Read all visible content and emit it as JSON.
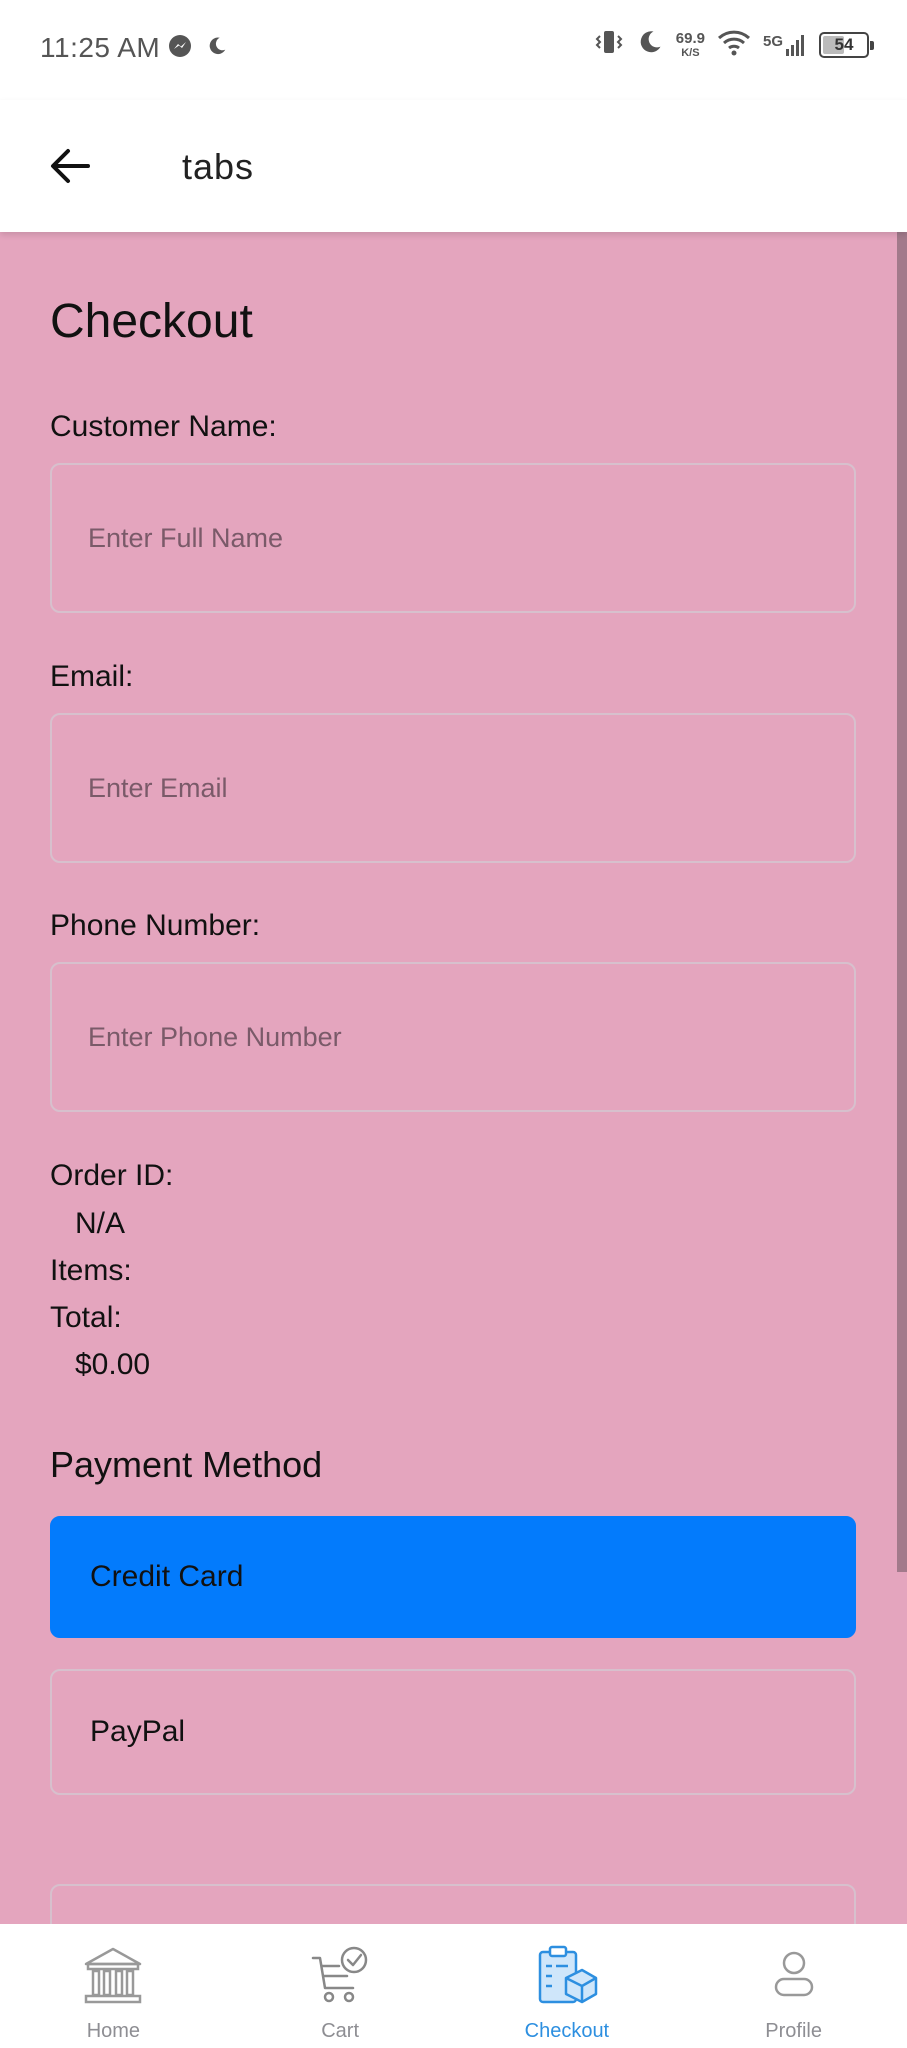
{
  "status_bar": {
    "time": "11:25 AM",
    "net_speed": "69.9",
    "net_speed_unit": "K/S",
    "network": "5G",
    "battery": "54",
    "battery_level": 0.54
  },
  "app_bar": {
    "title": "tabs"
  },
  "checkout": {
    "title": "Checkout",
    "customer_name_label": "Customer Name:",
    "customer_name_placeholder": "Enter Full Name",
    "email_label": "Email:",
    "email_placeholder": "Enter Email",
    "phone_label": "Phone Number:",
    "phone_placeholder": "Enter Phone Number",
    "order_id_label": "Order ID:",
    "order_id_value": "N/A",
    "items_label": "Items:",
    "total_label": "Total:",
    "total_value": "$0.00",
    "payment_title": "Payment Method",
    "payment_options": [
      {
        "label": "Credit Card",
        "selected": true
      },
      {
        "label": "PayPal",
        "selected": false
      }
    ]
  },
  "bottom_nav": {
    "items": [
      {
        "label": "Home",
        "icon": "bank-icon",
        "active": false
      },
      {
        "label": "Cart",
        "icon": "cart-check-icon",
        "active": false
      },
      {
        "label": "Checkout",
        "icon": "clipboard-package-icon",
        "active": true
      },
      {
        "label": "Profile",
        "icon": "person-icon",
        "active": false
      }
    ]
  },
  "colors": {
    "background": "#e4a5be",
    "selected_option": "#037bfc",
    "active_tab": "#2d8fe0",
    "inactive_tab": "#8e8e93"
  }
}
